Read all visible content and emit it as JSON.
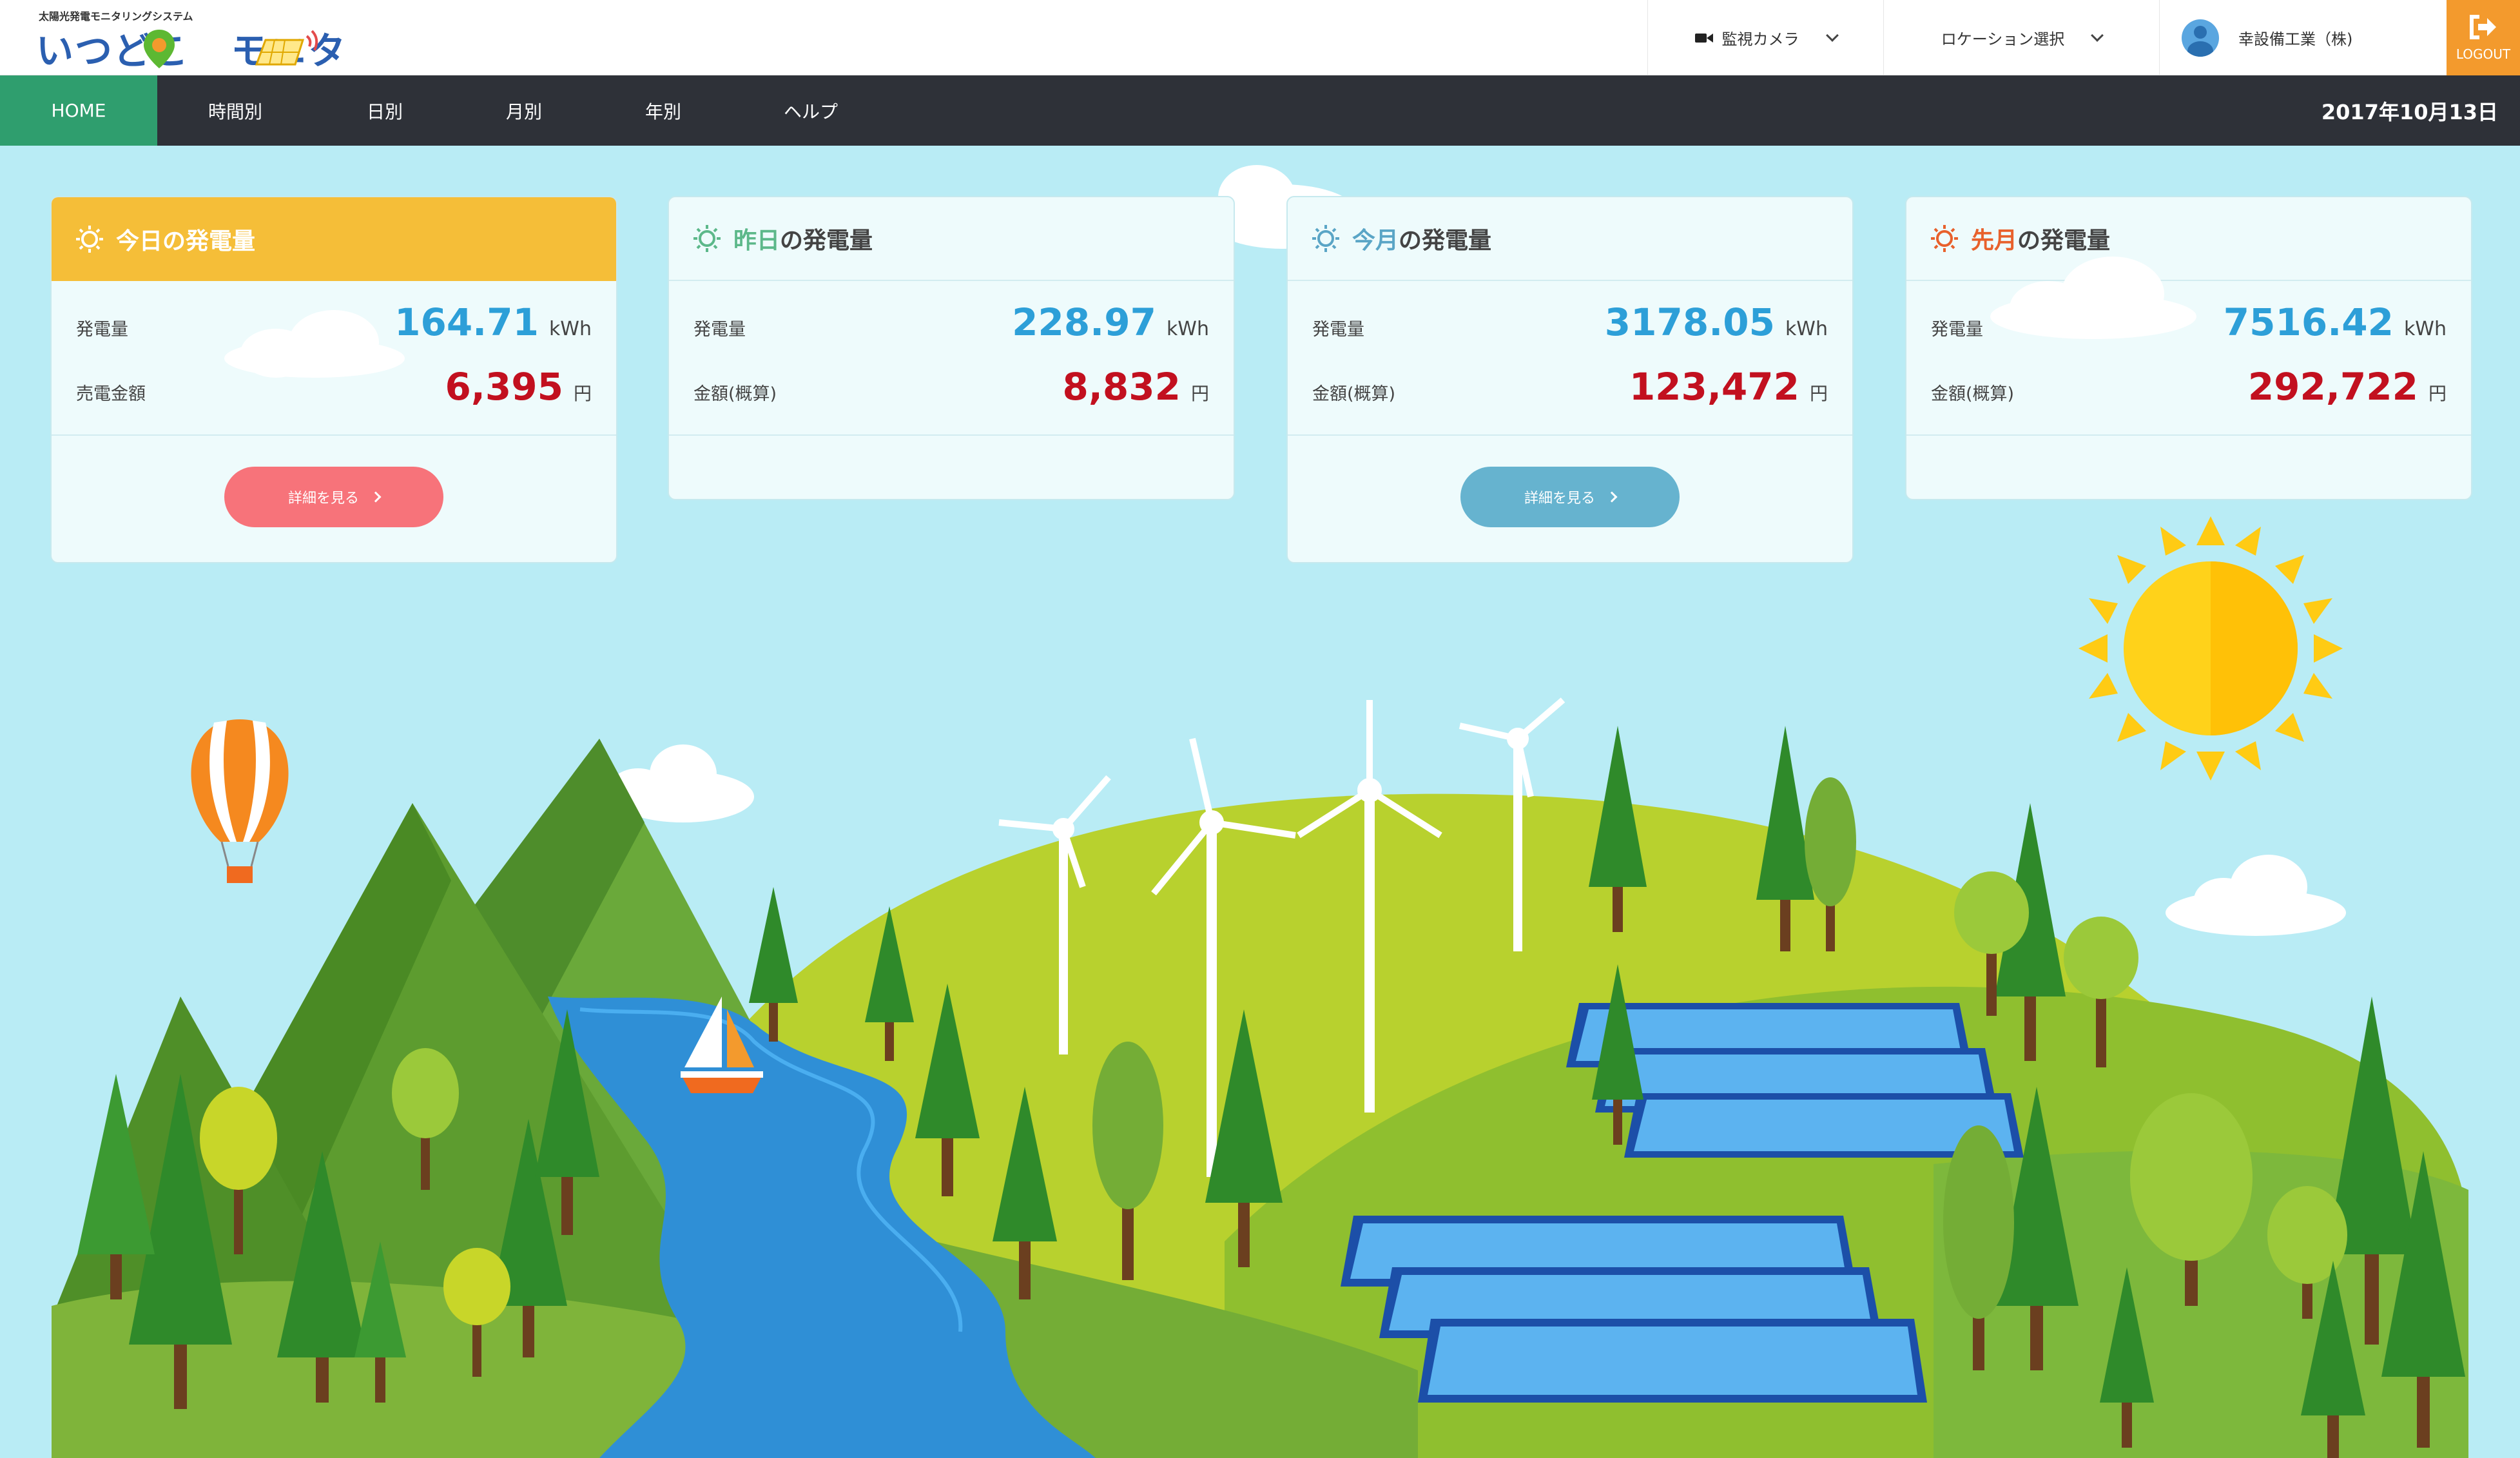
{
  "header": {
    "logo_subtitle": "太陽光発電モニタリングシステム",
    "logo_title": "いつどこ",
    "logo_title_2": "モニタ",
    "camera_label": "監視カメラ",
    "location_label": "ロケーション選択",
    "user_name": "幸設備工業（株)",
    "logout_label": "LOGOUT"
  },
  "nav": {
    "items": [
      {
        "label": "HOME",
        "active": true
      },
      {
        "label": "時間別"
      },
      {
        "label": "日別"
      },
      {
        "label": "月別"
      },
      {
        "label": "年別"
      },
      {
        "label": "ヘルプ"
      }
    ],
    "date": "2017年10月13日"
  },
  "cards": [
    {
      "title_a": "今日",
      "title_b": "の発電量",
      "row1_label": "発電量",
      "row1_value": "164.71",
      "row1_unit": "kWh",
      "row2_label": "売電金額",
      "row2_value": "6,395",
      "row2_unit": "円",
      "button_label": "詳細を見る",
      "accent": "#f5be38"
    },
    {
      "title_a": "昨日",
      "title_b": "の発電量",
      "row1_label": "発電量",
      "row1_value": "228.97",
      "row1_unit": "kWh",
      "row2_label": "金額(概算)",
      "row2_value": "8,832",
      "row2_unit": "円",
      "accent": "#5cb88a"
    },
    {
      "title_a": "今月",
      "title_b": "の発電量",
      "row1_label": "発電量",
      "row1_value": "3178.05",
      "row1_unit": "kWh",
      "row2_label": "金額(概算)",
      "row2_value": "123,472",
      "row2_unit": "円",
      "button_label": "詳細を見る",
      "accent": "#5aa5c6"
    },
    {
      "title_a": "先月",
      "title_b": "の発電量",
      "row1_label": "発電量",
      "row1_value": "7516.42",
      "row1_unit": "kWh",
      "row2_label": "金額(概算)",
      "row2_value": "292,722",
      "row2_unit": "円",
      "accent": "#e8612c"
    }
  ],
  "colors": {
    "nav_bg": "#2e3138",
    "nav_active": "#2f9e6e",
    "kwh_blue": "#2d9fd8",
    "yen_red": "#c2101f",
    "today_button": "#f7737a",
    "month_button": "#66b3cf",
    "logout_bg": "#f39a2d",
    "sky": "#b9ecf5"
  }
}
